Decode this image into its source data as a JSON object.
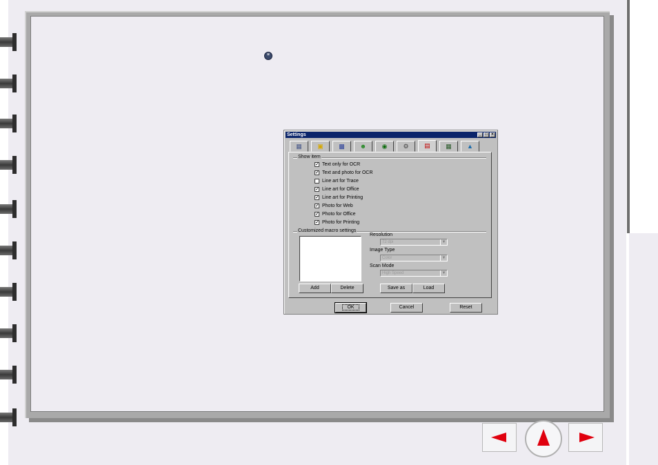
{
  "dialog": {
    "title": "Settings",
    "window_controls": [
      "_",
      "□",
      "×"
    ],
    "tabs": [
      "scanner-icon",
      "photo-folder-icon",
      "image-icon",
      "people-icon",
      "globe-icon",
      "gears-icon",
      "macro-icon",
      "grid-icon",
      "picture-icon"
    ],
    "active_tab_index": 6,
    "show_item": {
      "title": "Show item",
      "items": [
        {
          "label": "Text only for OCR",
          "checked": true
        },
        {
          "label": "Text and photo for OCR",
          "checked": true
        },
        {
          "label": "Line art for Trace",
          "checked": false
        },
        {
          "label": "Line art for Office",
          "checked": true
        },
        {
          "label": "Line art for Printing",
          "checked": true
        },
        {
          "label": "Photo for Web",
          "checked": true
        },
        {
          "label": "Photo for Office",
          "checked": true
        },
        {
          "label": "Photo for Printing",
          "checked": true
        }
      ]
    },
    "macro": {
      "title": "Customized macro settings",
      "resolution_label": "Resolution",
      "resolution_value": "72 dpi",
      "image_type_label": "Image Type",
      "image_type_value": "Color",
      "scan_mode_label": "Scan Mode",
      "scan_mode_value": "High Speed",
      "add_label": "Add",
      "delete_label": "Delete",
      "save_as_label": "Save as",
      "load_label": "Load"
    },
    "ok_label": "OK",
    "cancel_label": "Cancel",
    "reset_label": "Reset"
  },
  "bullet_glyph": "*",
  "navigation": {
    "prev_icon": "left-arrow-icon",
    "home_icon": "up-arrow-icon",
    "next_icon": "right-arrow-icon",
    "arrow_color": "#e0000e"
  }
}
